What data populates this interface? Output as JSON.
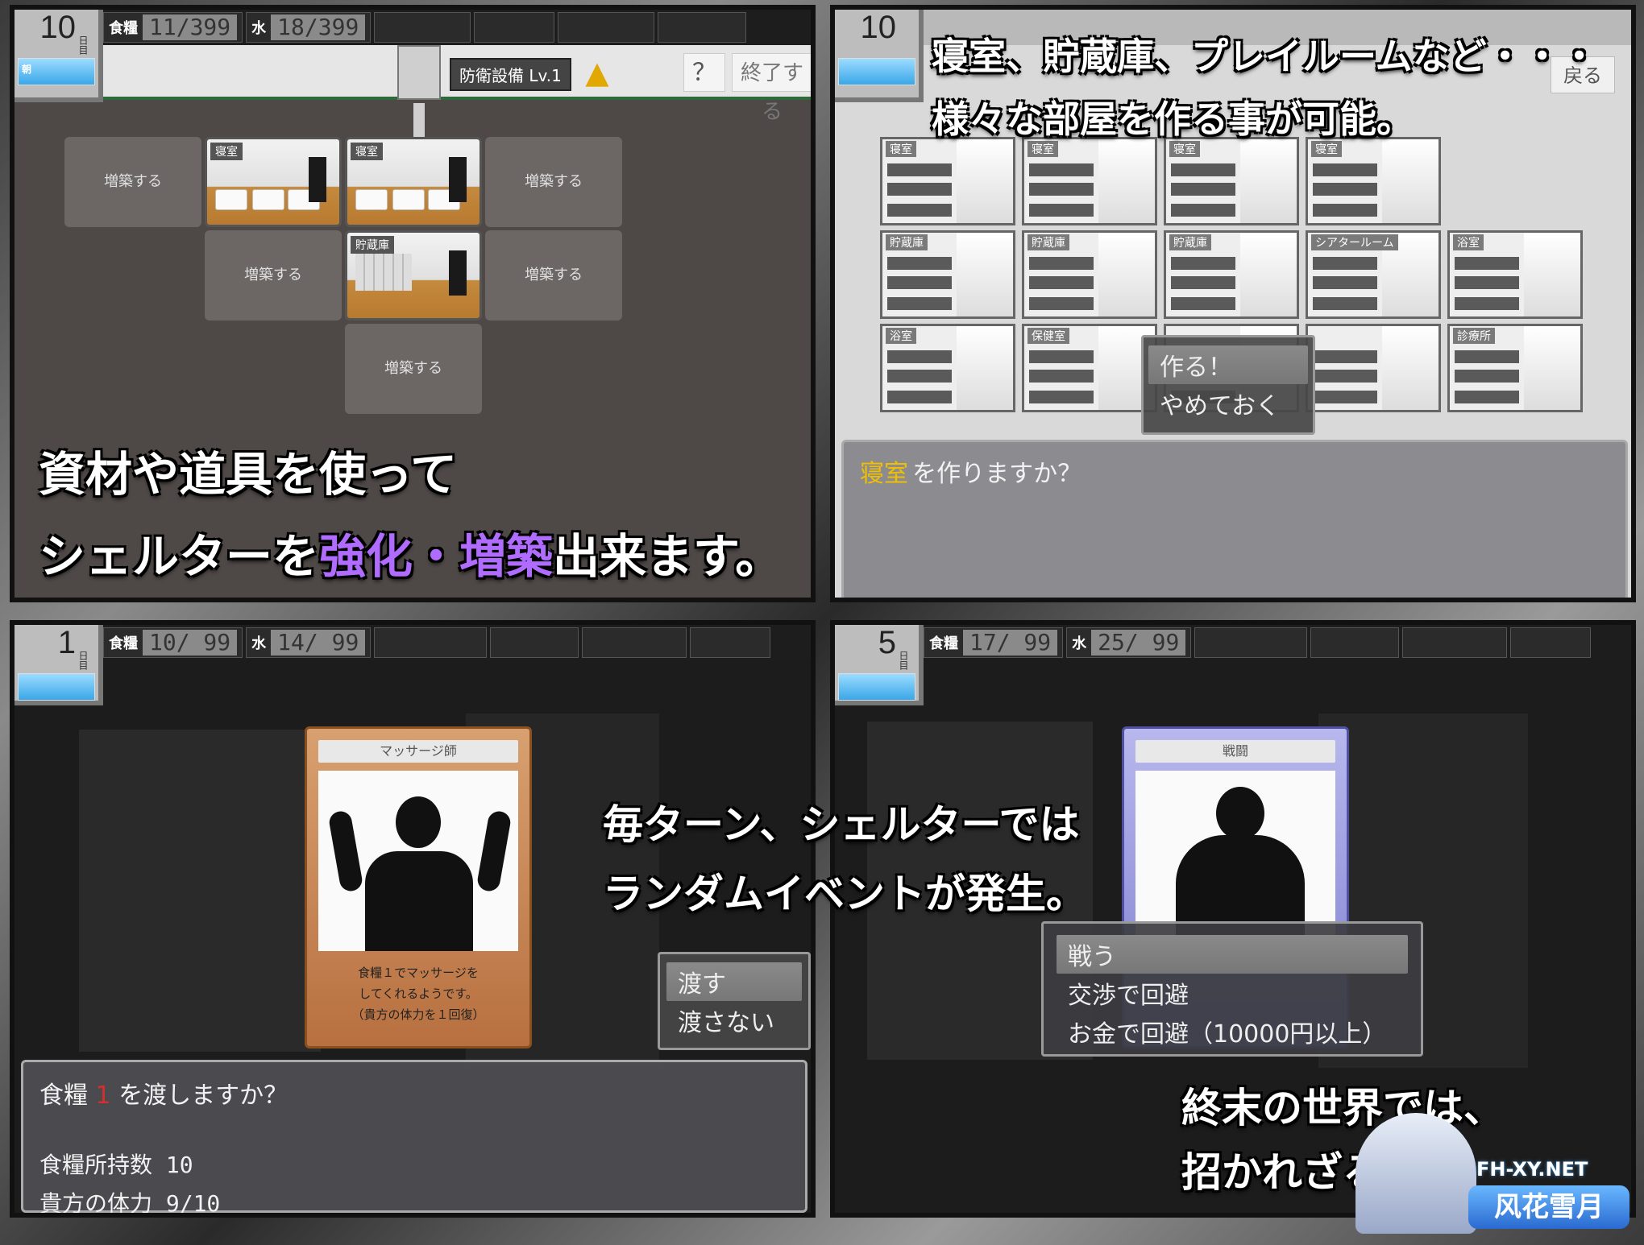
{
  "p1": {
    "day": "10",
    "day_unit": "日目",
    "day_bar_label": "朝",
    "hud": {
      "food_label": "食糧",
      "food_value": "11/399",
      "water_label": "水",
      "water_value": "18/399"
    },
    "toolbar": {
      "badge": "防衛設備 Lv.1",
      "up_glyph": "▲",
      "help": "？",
      "end": "終了する"
    },
    "cells": {
      "expand_label": "増築する",
      "room_label_bedroom": "寝室",
      "room_label_storage": "貯蔵庫"
    },
    "caption_line1": "資材や道具を使って",
    "caption_line2_a": "シェルターを",
    "caption_line2_hl": "強化・増築",
    "caption_line2_b": "出来ます。"
  },
  "p2": {
    "day": "10",
    "back": "戻る",
    "caption_line1": "寝室、貯蔵庫、プレイルームなど・・・",
    "caption_line2": "様々な部屋を作る事が可能。",
    "rooms": [
      {
        "title": "寝室"
      },
      {
        "title": "寝室"
      },
      {
        "title": "寝室"
      },
      {
        "title": "寝室"
      },
      {
        "title": "貯蔵庫"
      },
      {
        "title": "貯蔵庫"
      },
      {
        "title": "貯蔵庫"
      },
      {
        "title": "シアタールーム"
      },
      {
        "title": "浴室"
      },
      {
        "title": "浴室"
      },
      {
        "title": "保健室"
      },
      {
        "title": ""
      },
      {
        "title": ""
      },
      {
        "title": "診療所"
      }
    ],
    "menu": {
      "opt1": "作る！",
      "opt2": "やめておく"
    },
    "message_highlight": "寝室",
    "message_rest": "を作りますか？"
  },
  "p3": {
    "day": "1",
    "day_unit": "日目",
    "hud": {
      "food_label": "食糧",
      "food_value": "10/ 99",
      "water_label": "水",
      "water_value": "14/ 99"
    },
    "card_title": "マッサージ師",
    "card_desc1": "食糧１でマッサージを",
    "card_desc2": "してくれるようです。",
    "card_desc3": "（貴方の体力を１回復）",
    "menu": {
      "opt1": "渡す",
      "opt2": "渡さない"
    },
    "message_a": "食糧",
    "message_num": "1",
    "message_b": "を渡しますか？",
    "stat1": "食糧所持数 10",
    "stat2": "貴方の体力 9/10"
  },
  "p4": {
    "day": "5",
    "day_unit": "日目",
    "hud": {
      "food_label": "食糧",
      "food_value": "17/ 99",
      "water_label": "水",
      "water_value": "25/ 99"
    },
    "card_title": "戦闘",
    "menu": {
      "opt1": "戦う",
      "opt2": "交渉で回避",
      "opt3": "お金で回避（10000円以上）"
    },
    "caption_line1": "終末の世界では、",
    "caption_line2": "招かれざる"
  },
  "center_caption_line1": "毎ターン、シェルターでは",
  "center_caption_line2": "ランダムイベントが発生。",
  "watermark": {
    "url": "FH-XY.NET",
    "name": "风花雪月"
  },
  "colors": {
    "highlight_purple": "#b06cff",
    "highlight_yellow": "#f0c000",
    "highlight_red": "#d03030",
    "shelter_green": "#2e6b3a"
  }
}
